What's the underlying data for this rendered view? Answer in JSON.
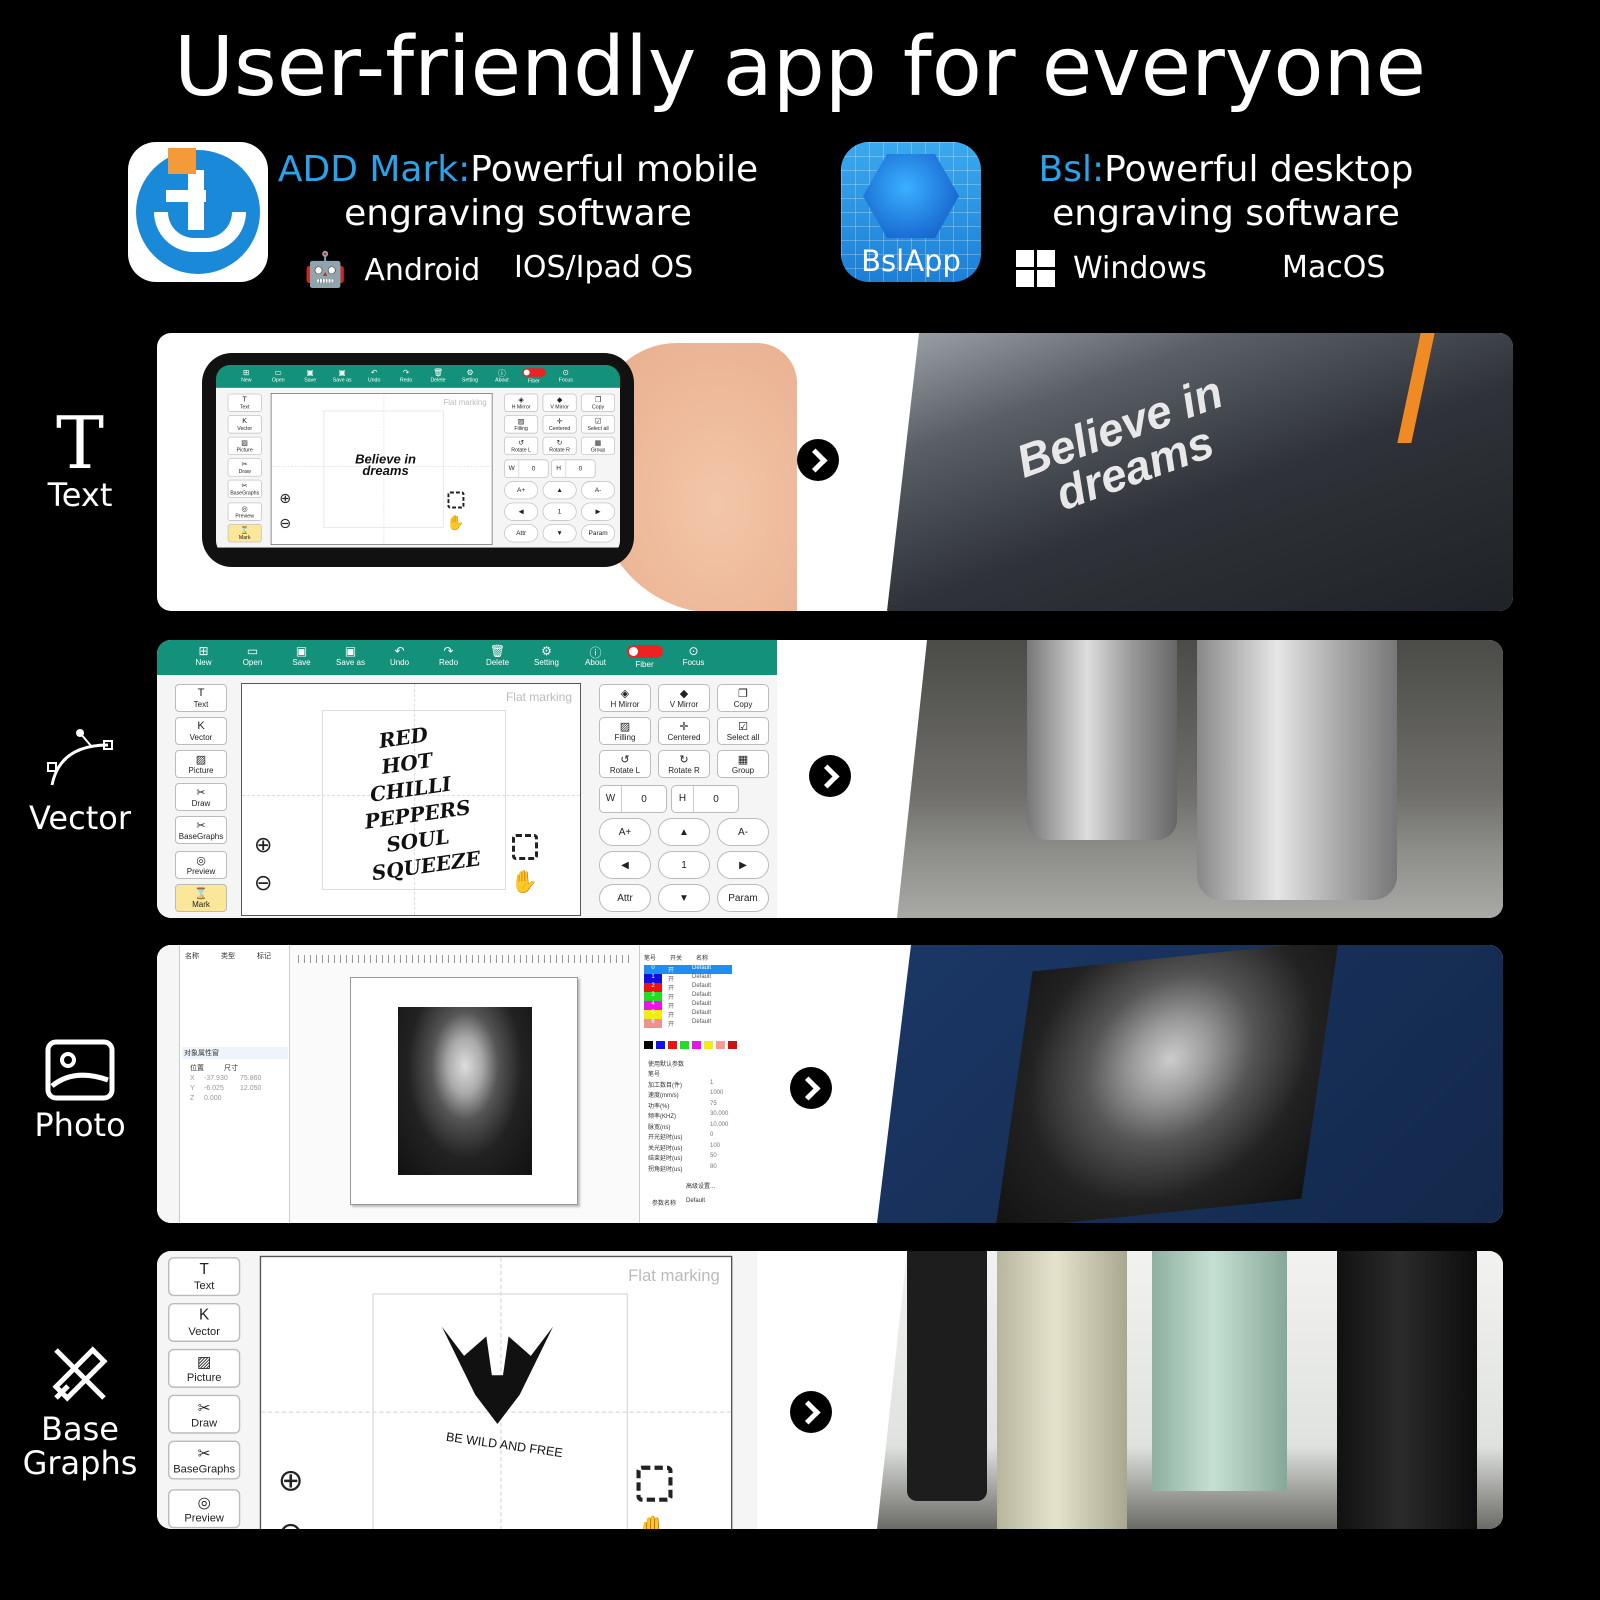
{
  "title": "User-friendly app for everyone",
  "apps": [
    {
      "name_hl": "ADD Mark:",
      "line1": "Powerful mobile",
      "line2": "engraving software",
      "icon": "add-mark-logo",
      "platforms": [
        {
          "icon": "android-icon",
          "label": "Android"
        },
        {
          "icon": "apple-icon",
          "label": "IOS/Ipad OS"
        }
      ]
    },
    {
      "name_hl": "Bsl:",
      "line1": "Powerful desktop",
      "line2": "engraving software",
      "icon": "bslapp-logo",
      "logo_text": "BslApp",
      "platforms": [
        {
          "icon": "windows-icon",
          "label": "Windows"
        },
        {
          "icon": "apple-icon",
          "label": "MacOS"
        }
      ]
    }
  ],
  "rows": [
    {
      "label": "Text",
      "icon": "text-icon",
      "photo_text": "Believe in dreams"
    },
    {
      "label": "Vector",
      "icon": "vector-pen-icon"
    },
    {
      "label": "Photo",
      "icon": "image-icon"
    },
    {
      "label": "Base Graphs",
      "icon": "base-graphs-icon"
    }
  ],
  "mobile": {
    "toolbar": [
      "New",
      "Open",
      "Save",
      "Save as",
      "Undo",
      "Redo",
      "Delete",
      "Setting",
      "About",
      "Fiber",
      "Focus"
    ],
    "tools": [
      "Text",
      "Vector",
      "Picture",
      "Draw",
      "BaseGraphs",
      "Preview",
      "Mark"
    ],
    "canvas_label": "Flat marking",
    "right_buttons": [
      "H Mirror",
      "V Mirror",
      "Copy",
      "Filling",
      "Centered",
      "Select all",
      "Rotate L",
      "Rotate R",
      "Group"
    ],
    "w_label": "W",
    "w_value": "0",
    "h_label": "H",
    "h_value": "0",
    "controls": [
      "A+",
      "▲",
      "A-",
      "◀",
      "1",
      "▶",
      "Attr",
      "▼",
      "Param"
    ],
    "sample_text": "Believe in dreams",
    "vector_art": "RED HOT CHILLI PEPPERS SOUL SQUEEZE",
    "deer_text": "BE WILD AND FREE",
    "accent": "#13917a"
  },
  "desktop": {
    "list_headers": [
      "名称",
      "类型",
      "标记"
    ],
    "props_title": "对象属性窗",
    "props_headers": [
      "位置",
      "尺寸"
    ],
    "props": [
      [
        "X",
        "-37.930",
        "75.860"
      ],
      [
        "Y",
        "-6.025",
        "12.050"
      ],
      [
        "Z",
        "0.000",
        ""
      ]
    ],
    "pen_headers": [
      "笔号",
      "开关",
      "名称"
    ],
    "pens": [
      {
        "n": "0",
        "c": "#1e8ff0"
      },
      {
        "n": "1",
        "c": "#1010e0"
      },
      {
        "n": "2",
        "c": "#ee1111"
      },
      {
        "n": "3",
        "c": "#22dd22"
      },
      {
        "n": "4",
        "c": "#ee11ee"
      },
      {
        "n": "5",
        "c": "#eeee11"
      },
      {
        "n": "6",
        "c": "#f09090"
      }
    ],
    "pen_on": "开",
    "pen_name": "Default",
    "use_default": "使用默认参数",
    "params": [
      [
        "笔号",
        ""
      ],
      [
        "加工数目(件)",
        "1"
      ],
      [
        "速度(mm/s)",
        "1000"
      ],
      [
        "功率(%)",
        "75"
      ],
      [
        "频率(KHZ)",
        "30.000"
      ],
      [
        "脉宽(ns)",
        "10.000"
      ],
      [
        "开光延时(us)",
        "0"
      ],
      [
        "关光延时(us)",
        "100"
      ],
      [
        "结束延时(us)",
        "50"
      ],
      [
        "拐角延时(us)",
        "80"
      ]
    ],
    "advanced": "高级设置...",
    "param_name_label": "参数名称",
    "param_name": "Default"
  }
}
